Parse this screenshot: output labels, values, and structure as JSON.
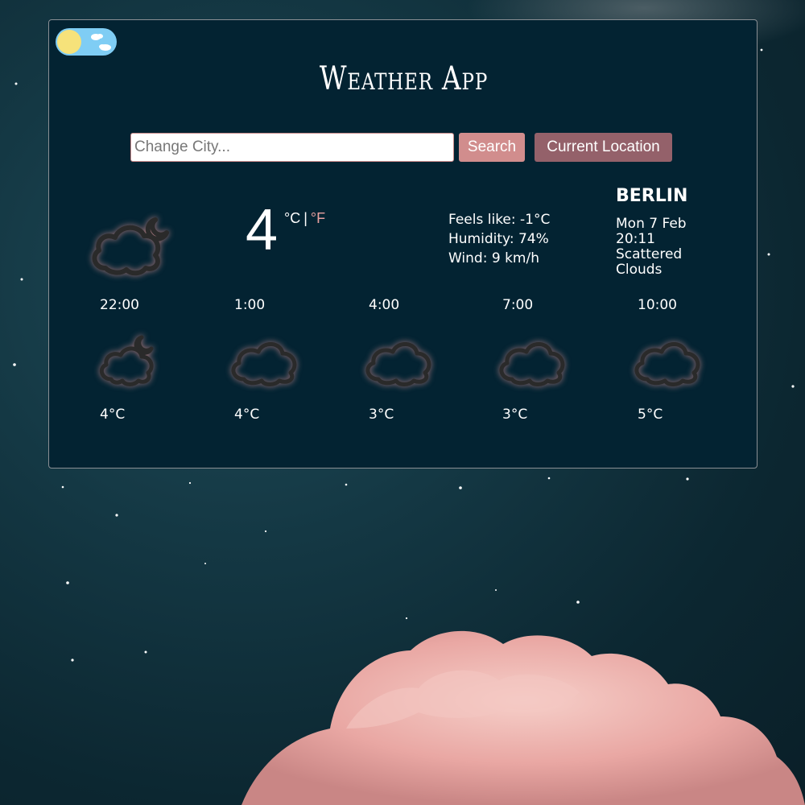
{
  "app": {
    "title": "Weather App"
  },
  "search": {
    "placeholder": "Change City...",
    "search_label": "Search",
    "location_label": "Current Location"
  },
  "current": {
    "temperature": "4",
    "unit_c": "°C",
    "unit_sep": "|",
    "unit_f": "°F",
    "feels_like": "Feels like: -1°C",
    "humidity": "Humidity: 74%",
    "wind": "Wind: 9 km/h",
    "city": "BERLIN",
    "date": "Mon 7 Feb",
    "time": "20:11",
    "description_line1": "Scattered",
    "description_line2": "Clouds",
    "icon": "cloud-moon-icon"
  },
  "forecast": [
    {
      "time": "22:00",
      "temp": "4°C",
      "icon": "cloud-moon-icon"
    },
    {
      "time": "1:00",
      "temp": "4°C",
      "icon": "cloud-icon"
    },
    {
      "time": "4:00",
      "temp": "3°C",
      "icon": "cloud-icon"
    },
    {
      "time": "7:00",
      "temp": "3°C",
      "icon": "cloud-icon"
    },
    {
      "time": "10:00",
      "temp": "5°C",
      "icon": "cloud-icon"
    }
  ],
  "theme": {
    "panel": "#032332",
    "accent": "#d18d8d",
    "accent_dark": "#94616a",
    "toggle": "#7fcdf4",
    "sun": "#f6e27a"
  },
  "toggle": {
    "icon": "day-night-toggle-icon"
  }
}
